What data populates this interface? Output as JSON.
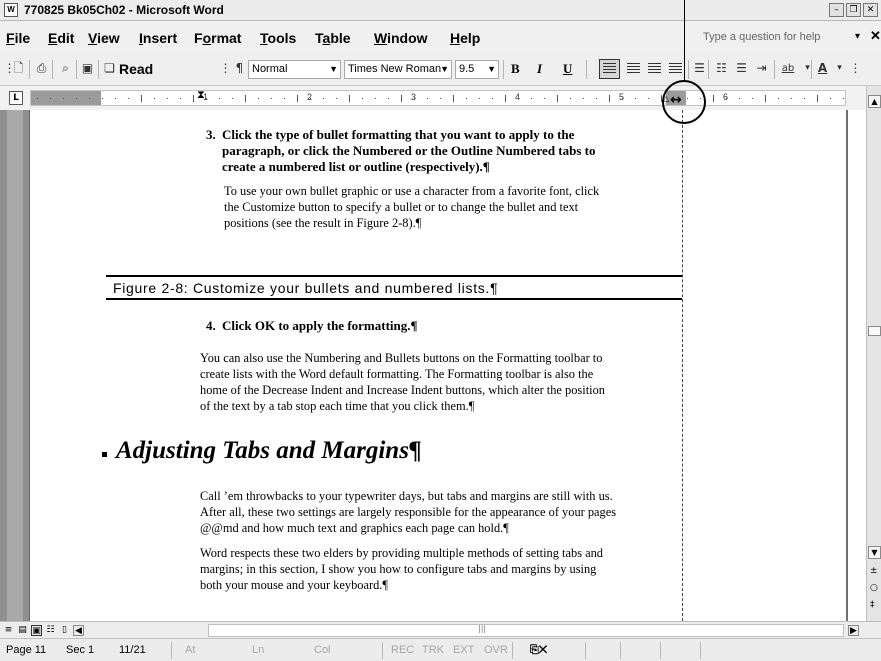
{
  "window": {
    "title": "770825 Bk05Ch02 - Microsoft Word",
    "app_icon": "word-icon",
    "controls": [
      "minimize-icon",
      "restore-icon",
      "close-icon"
    ]
  },
  "menubar": {
    "items": [
      {
        "label": "File",
        "underline_index": 0
      },
      {
        "label": "Edit",
        "underline_index": 0
      },
      {
        "label": "View",
        "underline_index": 0
      },
      {
        "label": "Insert",
        "underline_index": 0
      },
      {
        "label": "Format",
        "underline_index": 1
      },
      {
        "label": "Tools",
        "underline_index": 0
      },
      {
        "label": "Table",
        "underline_index": 1
      },
      {
        "label": "Window",
        "underline_index": 0
      },
      {
        "label": "Help",
        "underline_index": 0
      }
    ],
    "help_placeholder": "Type a question for help"
  },
  "toolbar": {
    "read_label": "Read",
    "style": "Normal",
    "font": "Times New Roman",
    "size": "9.5",
    "bold": "B",
    "italic": "I",
    "underline": "U",
    "highlight": "ab"
  },
  "ruler": {
    "numbers": [
      "1",
      "2",
      "3",
      "4",
      "5",
      "6"
    ],
    "tab_selector": "L"
  },
  "document": {
    "step3": {
      "number": "3.",
      "lines": [
        "Click the type of bullet formatting that you want to apply to the",
        "paragraph, or click the Numbered or the Outline Numbered tabs to",
        "create a numbered list or outline (respectively).¶"
      ]
    },
    "step3_body": [
      "To use your own bullet graphic or use a character from a favorite font, click",
      "the Customize button to specify a bullet or to change the bullet and text",
      "positions (see the result in Figure 2-8).¶"
    ],
    "figure_caption": "Figure 2-8: Customize your bullets and numbered lists.¶",
    "step4": {
      "number": "4.",
      "text": "Click OK to apply the formatting.¶"
    },
    "para1": [
      "You can also use the Numbering and Bullets buttons on the Formatting toolbar to",
      "create lists with the Word default formatting. The Formatting toolbar is also the",
      "home of the Decrease Indent and Increase Indent buttons, which alter the position",
      "of the text by a tab stop each time that you click them.¶"
    ],
    "heading": "Adjusting Tabs and Margins¶",
    "para2": [
      "Call ’em throwbacks to your typewriter days, but tabs and margins are still with us.",
      "After all, these two settings are largely responsible for the appearance of your pages",
      "@@md and how much text and graphics each page can hold.¶"
    ],
    "para3": [
      "Word respects these two elders by providing multiple methods of setting tabs and",
      "margins; in this section, I show you how to configure tabs and margins by using",
      "both your mouse and your keyboard.¶"
    ]
  },
  "statusbar": {
    "page": "Page 11",
    "section": "Sec 1",
    "pages": "11/21",
    "at": "At",
    "ln": "Ln",
    "col": "Col",
    "rec": "REC",
    "trk": "TRK",
    "ext": "EXT",
    "ovr": "OVR"
  }
}
